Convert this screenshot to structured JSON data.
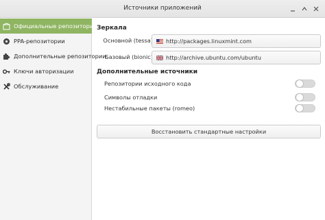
{
  "window": {
    "title": "Источники приложений"
  },
  "sidebar": {
    "items": [
      {
        "label": "Официальные репозитории",
        "icon": "box-icon"
      },
      {
        "label": "PPA-репозитории",
        "icon": "ppa-icon"
      },
      {
        "label": "Дополнительные репозитории",
        "icon": "puzzle-icon"
      },
      {
        "label": "Ключи авторизации",
        "icon": "key-icon"
      },
      {
        "label": "Обслуживание",
        "icon": "tools-icon"
      }
    ],
    "active_color": "#8fb562"
  },
  "mirrors": {
    "title": "Зеркала",
    "main_label": "Основной (tessa)",
    "main_value": "http://packages.linuxmint.com",
    "main_flag": "us-flag-icon",
    "base_label": "Базовый (bionic)",
    "base_value": "http://archive.ubuntu.com/ubuntu",
    "base_flag": "uk-flag-icon"
  },
  "extra": {
    "title": "Дополнительные источники",
    "items": [
      {
        "label": "Репозитории исходного кода",
        "enabled": false
      },
      {
        "label": "Символы отладки",
        "enabled": false
      },
      {
        "label": "Нестабильные пакеты (romeo)",
        "enabled": false
      }
    ]
  },
  "restore_button": "Восстановить стандартные настройки"
}
